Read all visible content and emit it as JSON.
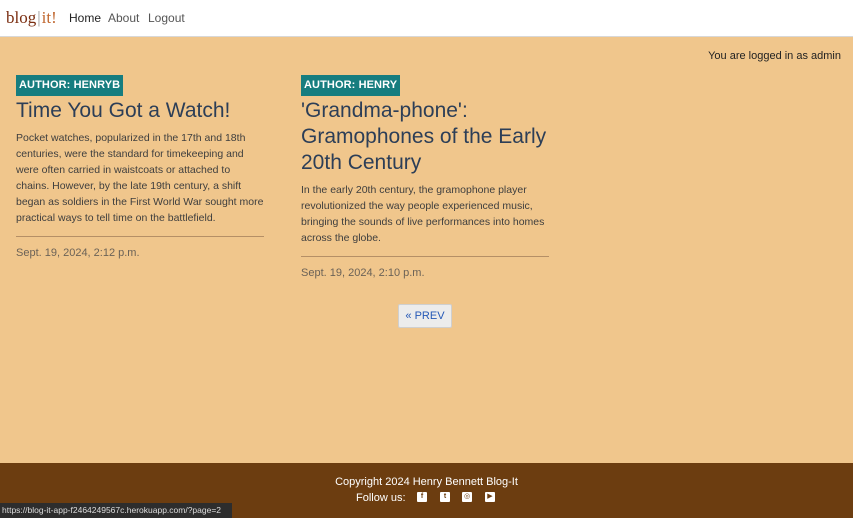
{
  "nav": {
    "brand_left": "blog",
    "brand_right": "it!",
    "links": [
      "Home",
      "About",
      "Logout"
    ]
  },
  "status": "You are logged in as admin",
  "posts": [
    {
      "author": "AUTHOR: HENRYB",
      "title": "Time You Got a Watch!",
      "excerpt": "Pocket watches, popularized in the 17th and 18th centuries, were the standard for timekeeping and were often carried in waistcoats or attached to chains. However, by the late 19th century, a shift began as soldiers in the First World War sought more practical ways to tell time on the battlefield.",
      "date": "Sept. 19, 2024, 2:12 p.m."
    },
    {
      "author": "AUTHOR: HENRY",
      "title": "'Grandma-phone': Gramophones of the Early 20th Century",
      "excerpt": "In the early 20th century, the gramophone player revolutionized the way people experienced music, bringing the sounds of live performances into homes across the globe.",
      "date": "Sept. 19, 2024, 2:10 p.m."
    }
  ],
  "pagination": {
    "prev_label": "« PREV"
  },
  "footer": {
    "copyright": "Copyright 2024 Henry Bennett Blog-It",
    "follow_label": "Follow us:",
    "social_icons": [
      "facebook-icon",
      "twitter-icon",
      "instagram-icon",
      "youtube-icon"
    ]
  },
  "link_status": "https://blog-it-app-f2464249567c.herokuapp.com/?page=2",
  "colors": {
    "page_bg": "#f0c68c",
    "badge": "#167d7f",
    "footer_bg": "#6c3d10",
    "title": "#2c3e57"
  }
}
